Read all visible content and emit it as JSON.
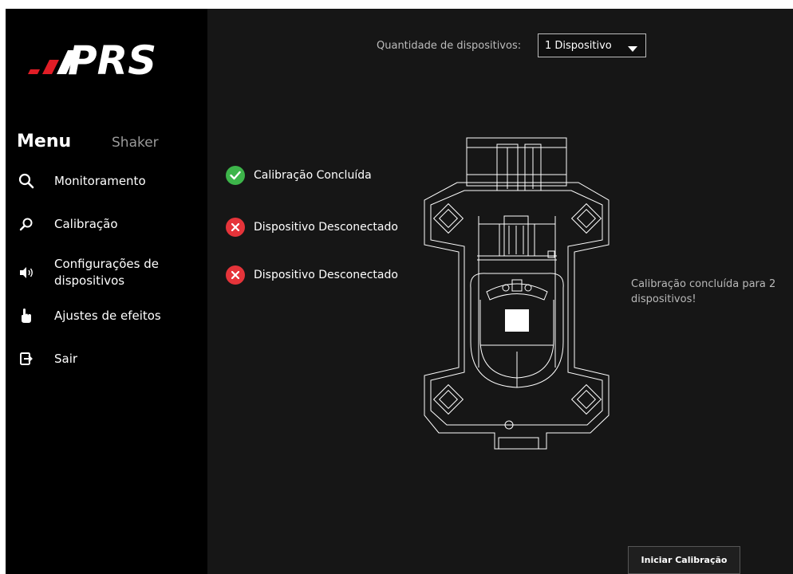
{
  "brand": {
    "logo_text": "PRS"
  },
  "sidebar": {
    "menu_title": "Menu",
    "menu_subtitle": "Shaker",
    "items": [
      {
        "label": "Monitoramento",
        "icon": "search-icon"
      },
      {
        "label": "Calibração",
        "icon": "magnifier-icon"
      },
      {
        "label": "Configurações de\ndispositivos",
        "icon": "speaker-icon"
      },
      {
        "label": "Ajustes de efeitos",
        "icon": "hand-pointer-icon"
      },
      {
        "label": "Sair",
        "icon": "exit-icon"
      }
    ]
  },
  "header": {
    "quantity_label": "Quantidade de dispositivos:",
    "quantity_value": "1 Dispositivo"
  },
  "devices": [
    {
      "status": "Calibração Concluída",
      "state": "ok"
    },
    {
      "status": "Dispositivo Desconectado",
      "state": "error"
    },
    {
      "status": "Dispositivo Desconectado",
      "state": "error"
    }
  ],
  "calibration_message": "Calibração concluída para 2 dispositivos!",
  "start_button_label": "Iniciar Calibração",
  "colors": {
    "ok": "#3db54a",
    "error": "#e5343a",
    "sidebar_bg": "#000000",
    "main_bg": "#161616"
  }
}
